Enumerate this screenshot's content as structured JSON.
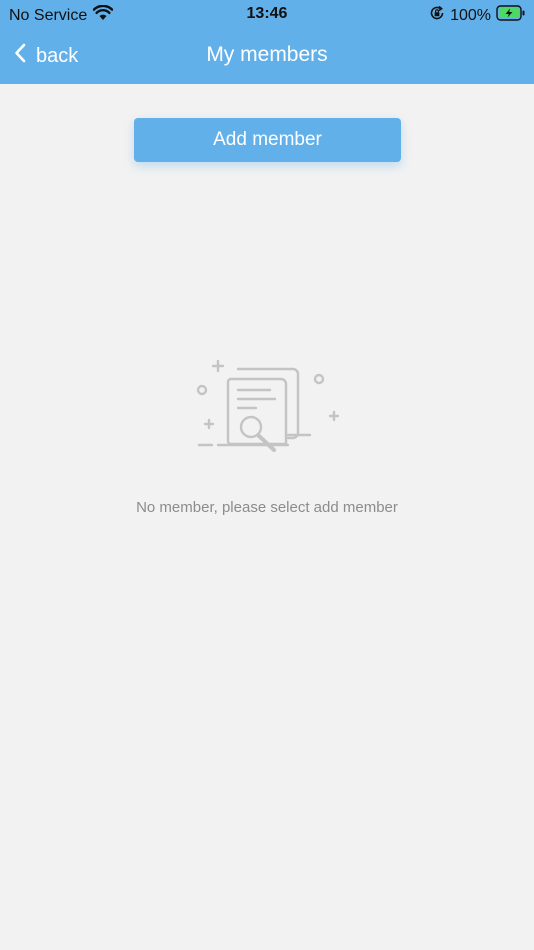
{
  "status_bar": {
    "carrier": "No Service",
    "time": "13:46",
    "battery_percent": "100%",
    "icons": [
      "wifi-icon",
      "orientation-lock-icon",
      "battery-charging-icon"
    ]
  },
  "nav": {
    "back_label": "back",
    "title": "My members",
    "icons": [
      "chevron-left-icon"
    ]
  },
  "main": {
    "add_button_label": "Add member",
    "empty_message": "No member, please select add member",
    "empty_icon": "empty-document-search-icon"
  },
  "colors": {
    "accent": "#62b0ea",
    "background": "#f2f2f2",
    "empty_text": "#8c8c8c",
    "illustration": "#c4c4c4"
  }
}
